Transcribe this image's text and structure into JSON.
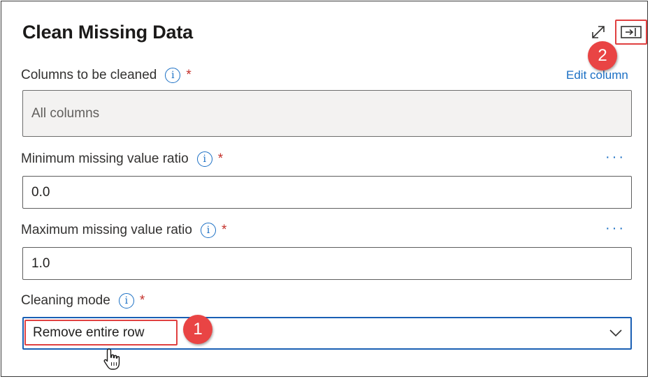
{
  "panel": {
    "title": "Clean Missing Data"
  },
  "columns": {
    "label": "Columns to be cleaned",
    "required_mark": "*",
    "info_glyph": "i",
    "edit_link": "Edit column",
    "value": "All columns"
  },
  "min_ratio": {
    "label": "Minimum missing value ratio",
    "required_mark": "*",
    "info_glyph": "i",
    "more_glyph": "···",
    "value": "0.0"
  },
  "max_ratio": {
    "label": "Maximum missing value ratio",
    "required_mark": "*",
    "info_glyph": "i",
    "more_glyph": "···",
    "value": "1.0"
  },
  "cleaning_mode": {
    "label": "Cleaning mode",
    "required_mark": "*",
    "info_glyph": "i",
    "selected": "Remove entire row"
  },
  "annotations": {
    "step1": "1",
    "step2": "2"
  },
  "icons": {
    "expand": "expand-icon",
    "collapse": "collapse-panel-icon",
    "chevron": "chevron-down-icon",
    "cursor": "hand-pointer-icon"
  },
  "colors": {
    "accent": "#1a6fc4",
    "required": "#c4312b",
    "highlight": "#e04040",
    "badge": "#e94444"
  }
}
